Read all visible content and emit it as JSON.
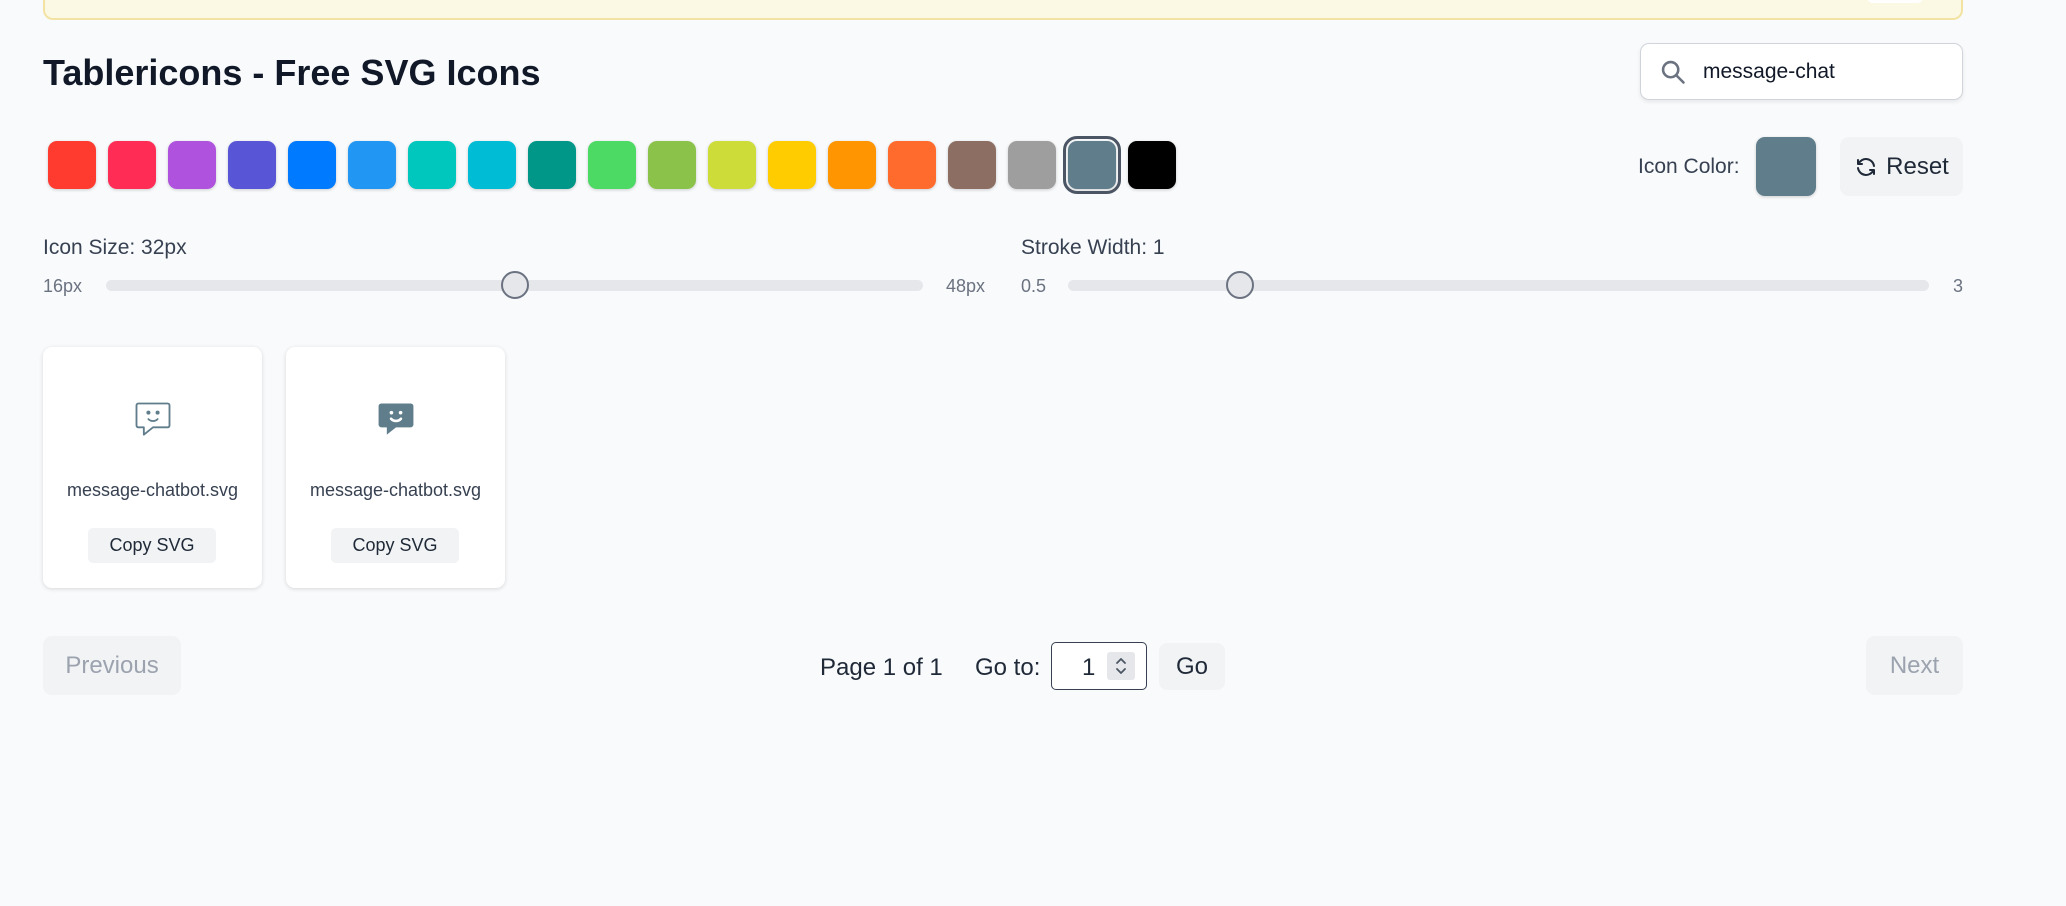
{
  "page": {
    "title": "Tablericons - Free SVG Icons"
  },
  "search": {
    "value": "message-chat",
    "icon": "search-icon"
  },
  "palette": {
    "swatches": [
      "#ff3b30",
      "#ff2d55",
      "#af52de",
      "#5856d6",
      "#007aff",
      "#2196f3",
      "#00c7be",
      "#00bcd4",
      "#009688",
      "#4cd964",
      "#8bc34a",
      "#cddc39",
      "#ffcc00",
      "#ff9500",
      "#ff6b2c",
      "#8d6e63",
      "#9e9e9e",
      "#607d8b",
      "#000000"
    ],
    "selected_index": 17,
    "icon_color_label": "Icon Color:",
    "icon_color": "#607d8b",
    "reset_label": "Reset",
    "reset_icon": "refresh-icon"
  },
  "size_slider": {
    "label": "Icon Size: 32px",
    "min_label": "16px",
    "max_label": "48px",
    "min": 16,
    "max": 48,
    "value": 32
  },
  "stroke_slider": {
    "label": "Stroke Width: 1",
    "min_label": "0.5",
    "max_label": "3",
    "min": 0.5,
    "max": 3,
    "value": 1
  },
  "icons": [
    {
      "name": "message-chatbot.svg",
      "copy_label": "Copy SVG",
      "style": "outline",
      "icon": "message-chatbot-icon"
    },
    {
      "name": "message-chatbot.svg",
      "copy_label": "Copy SVG",
      "style": "filled",
      "icon": "message-chatbot-filled-icon"
    }
  ],
  "pagination": {
    "previous_label": "Previous",
    "next_label": "Next",
    "page_info": "Page 1 of 1",
    "goto_label": "Go to:",
    "goto_value": "1",
    "go_label": "Go"
  }
}
